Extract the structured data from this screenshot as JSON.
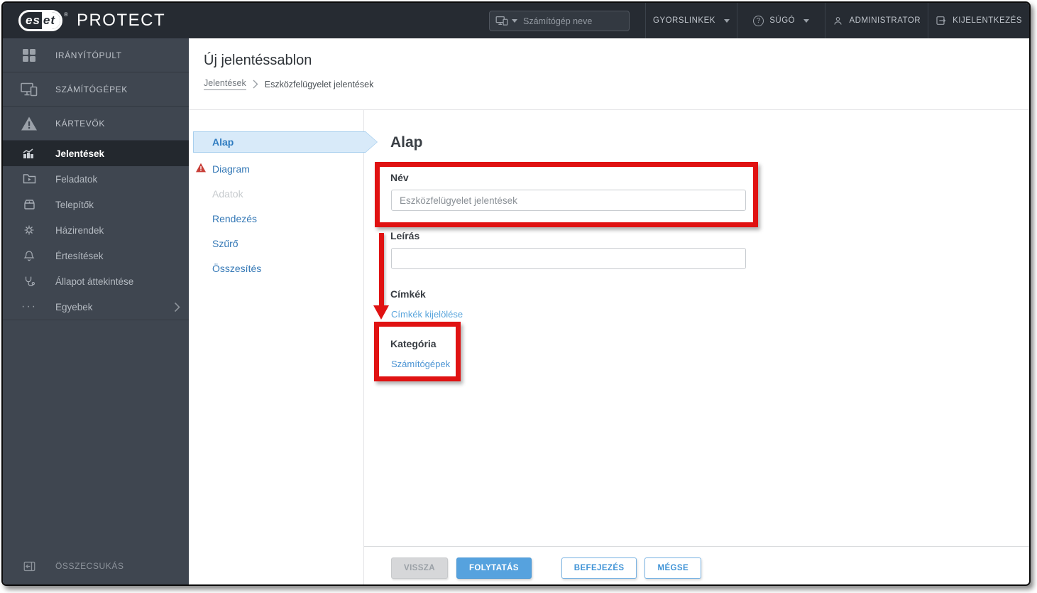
{
  "topbar": {
    "logo": {
      "brand_prefix": "es",
      "brand_suffix": "et",
      "registered": "®",
      "product": "PROTECT"
    },
    "search": {
      "placeholder": "Számítógép neve",
      "icon": "computer-icon"
    },
    "items": [
      {
        "label": "GYORSLINKEK",
        "icon": "none",
        "has_dropdown": true
      },
      {
        "label": "SÚGÓ",
        "icon": "help-icon",
        "has_dropdown": true
      },
      {
        "label": "ADMINISTRATOR",
        "icon": "user-icon",
        "has_dropdown": false
      },
      {
        "label": "KIJELENTKEZÉS",
        "icon": "logout-icon",
        "has_dropdown": false
      }
    ]
  },
  "sidebar": {
    "primary": [
      {
        "label": "IRÁNYÍTÓPULT",
        "icon": "dashboard-grid-icon"
      },
      {
        "label": "SZÁMÍTÓGÉPEK",
        "icon": "computers-icon"
      },
      {
        "label": "KÁRTEVŐK",
        "icon": "threats-warning-icon"
      }
    ],
    "secondary": [
      {
        "label": "Jelentések",
        "icon": "reports-chart-icon",
        "active": true
      },
      {
        "label": "Feladatok",
        "icon": "tasks-folder-icon",
        "active": false
      },
      {
        "label": "Telepítők",
        "icon": "installers-icon",
        "active": false
      },
      {
        "label": "Házirendek",
        "icon": "policies-gear-icon",
        "active": false
      },
      {
        "label": "Értesítések",
        "icon": "notifications-bell-icon",
        "active": false
      },
      {
        "label": "Állapot áttekintése",
        "icon": "status-overview-icon",
        "active": false
      },
      {
        "label": "Egyebek",
        "icon": "more-ellipsis-icon",
        "active": false,
        "has_submenu": true
      }
    ],
    "collapse_label": "ÖSSZECSUKÁS"
  },
  "page": {
    "title": "Új jelentéssablon",
    "breadcrumb": {
      "parent": "Jelentések",
      "current": "Eszközfelügyelet jelentések"
    }
  },
  "wizard": {
    "steps": [
      {
        "label": "Alap",
        "state": "active"
      },
      {
        "label": "Diagram",
        "state": "error"
      },
      {
        "label": "Adatok",
        "state": "disabled"
      },
      {
        "label": "Rendezés",
        "state": "enabled"
      },
      {
        "label": "Szűrő",
        "state": "enabled"
      },
      {
        "label": "Összesítés",
        "state": "enabled"
      }
    ]
  },
  "form": {
    "heading": "Alap",
    "name": {
      "label": "Név",
      "value": "Eszközfelügyelet jelentések"
    },
    "description": {
      "label": "Leírás",
      "value": ""
    },
    "tags": {
      "label": "Címkék",
      "link": "Címkék kijelölése"
    },
    "category": {
      "label": "Kategória",
      "link": "Számítógépek"
    }
  },
  "footer": {
    "buttons": [
      {
        "label": "VISSZA",
        "style": "disabled"
      },
      {
        "label": "FOLYTATÁS",
        "style": "primary"
      },
      {
        "label": "BEFEJEZÉS",
        "style": "outline"
      },
      {
        "label": "MÉGSE",
        "style": "outline"
      }
    ]
  },
  "colors": {
    "topbar_bg": "#262b32",
    "sidebar_bg": "#3f4650",
    "active_item_bg": "#23282e",
    "accent_blue": "#4b94d4",
    "active_step_fill": "#d8eaf9",
    "primary_button": "#56a2de",
    "annotation_red": "#e01212"
  }
}
